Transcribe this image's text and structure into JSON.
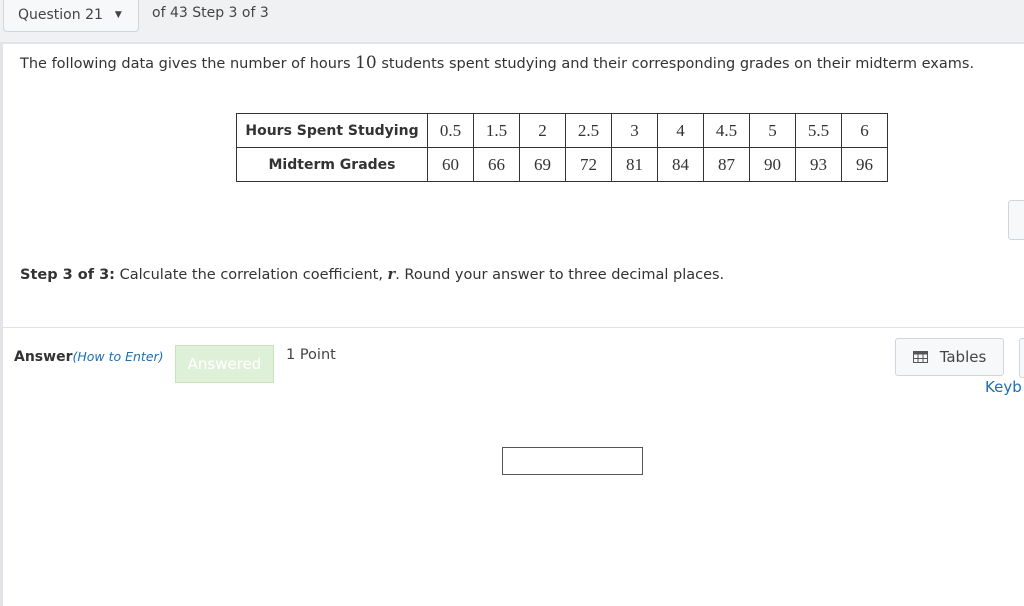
{
  "header": {
    "question_label": "Question 21",
    "progress": "of 43 Step 3 of 3"
  },
  "intro": {
    "before": "The following data gives the number of hours ",
    "number": "10",
    "after": " students spent studying and their corresponding grades on their midterm exams."
  },
  "table": {
    "rows": [
      {
        "header": "Hours Spent Studying",
        "values": [
          "0.5",
          "1.5",
          "2",
          "2.5",
          "3",
          "4",
          "4.5",
          "5",
          "5.5",
          "6"
        ]
      },
      {
        "header": "Midterm Grades",
        "values": [
          "60",
          "66",
          "69",
          "72",
          "81",
          "84",
          "87",
          "90",
          "93",
          "96"
        ]
      }
    ]
  },
  "step": {
    "label": "Step 3 of 3:",
    "text1": " Calculate the correlation coefficient, ",
    "var": "r",
    "text2": ". Round your answer to three decimal places."
  },
  "answer": {
    "label": "Answer",
    "how_to": "(How to Enter)",
    "status": "Answered",
    "points": "1 Point",
    "value": ""
  },
  "tools": {
    "tables_label": "Tables",
    "tables_icon": "table-grid-icon",
    "keyboard_label": "Keyb"
  }
}
